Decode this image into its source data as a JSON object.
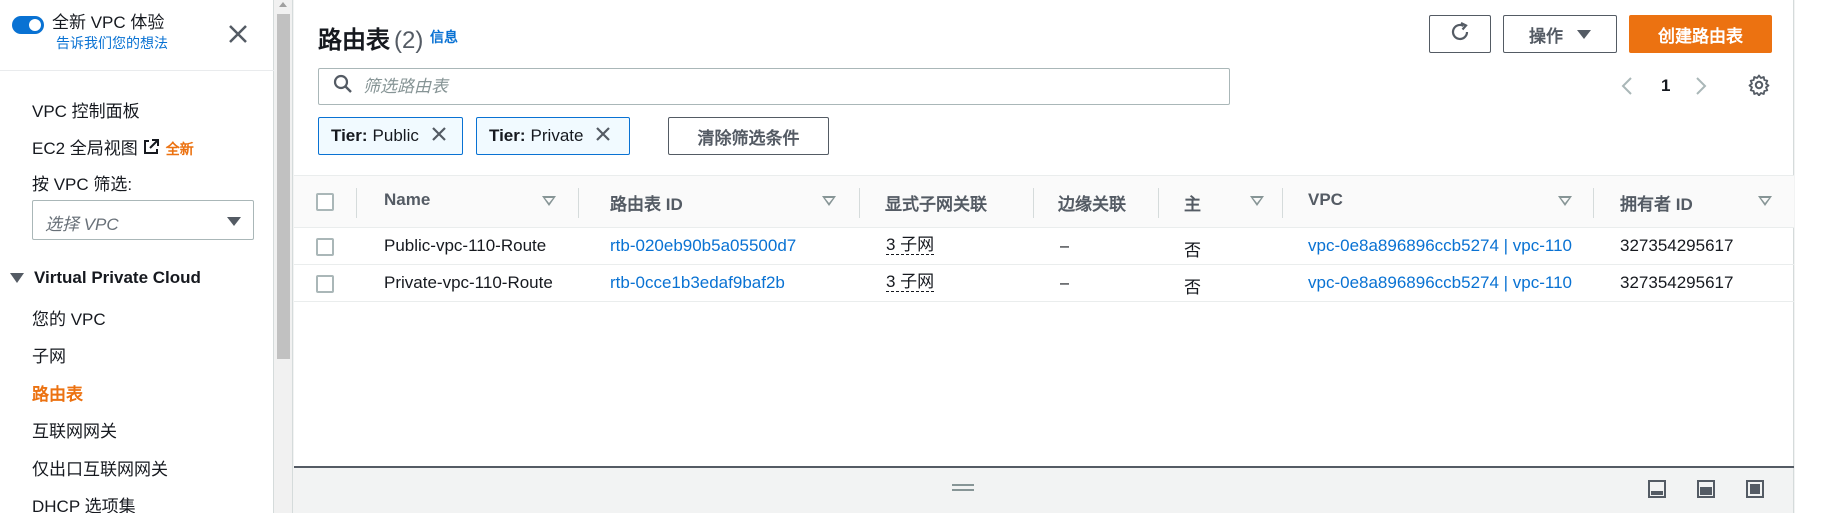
{
  "sidebar": {
    "toggle_title": "全新 VPC 体验",
    "toggle_sub": "告诉我们您的想法",
    "nav": {
      "dashboard": "VPC 控制面板",
      "ec2_global": "EC2 全局视图",
      "ec2_badge": "全新"
    },
    "filter_label": "按 VPC 筛选:",
    "filter_placeholder": "选择 VPC",
    "section": "Virtual Private Cloud",
    "items": [
      {
        "label": "您的 VPC"
      },
      {
        "label": "子网"
      },
      {
        "label": "路由表"
      },
      {
        "label": "互联网网关"
      },
      {
        "label": "仅出口互联网网关"
      },
      {
        "label": "DHCP 选项集"
      }
    ],
    "active_item": "路由表"
  },
  "header": {
    "title": "路由表",
    "count": "(2)",
    "info": "信息",
    "actions_label": "操作",
    "create_label": "创建路由表"
  },
  "search": {
    "placeholder": "筛选路由表",
    "value": ""
  },
  "pagination": {
    "current_page": "1"
  },
  "filters": {
    "chips": [
      {
        "key": "Tier:",
        "value": "Public"
      },
      {
        "key": "Tier:",
        "value": "Private"
      }
    ],
    "clear_label": "清除筛选条件"
  },
  "table": {
    "columns": [
      "Name",
      "路由表 ID",
      "显式子网关联",
      "边缘关联",
      "主",
      "VPC",
      "拥有者 ID"
    ],
    "rows": [
      {
        "name": "Public-vpc-110-Route",
        "route_table_id": "rtb-020eb90b5a05500d7",
        "explicit_subnets": "3 子网",
        "edge_assoc": "–",
        "main": "否",
        "vpc": "vpc-0e8a896896ccb5274 | vpc-110",
        "owner_id": "327354295617"
      },
      {
        "name": "Private-vpc-110-Route",
        "route_table_id": "rtb-0cce1b3edaf9baf2b",
        "explicit_subnets": "3 子网",
        "edge_assoc": "–",
        "main": "否",
        "vpc": "vpc-0e8a896896ccb5274 | vpc-110",
        "owner_id": "327354295617"
      }
    ]
  },
  "colors": {
    "accent": "#ec7211",
    "link": "#0972d3",
    "text": "#16191f"
  }
}
